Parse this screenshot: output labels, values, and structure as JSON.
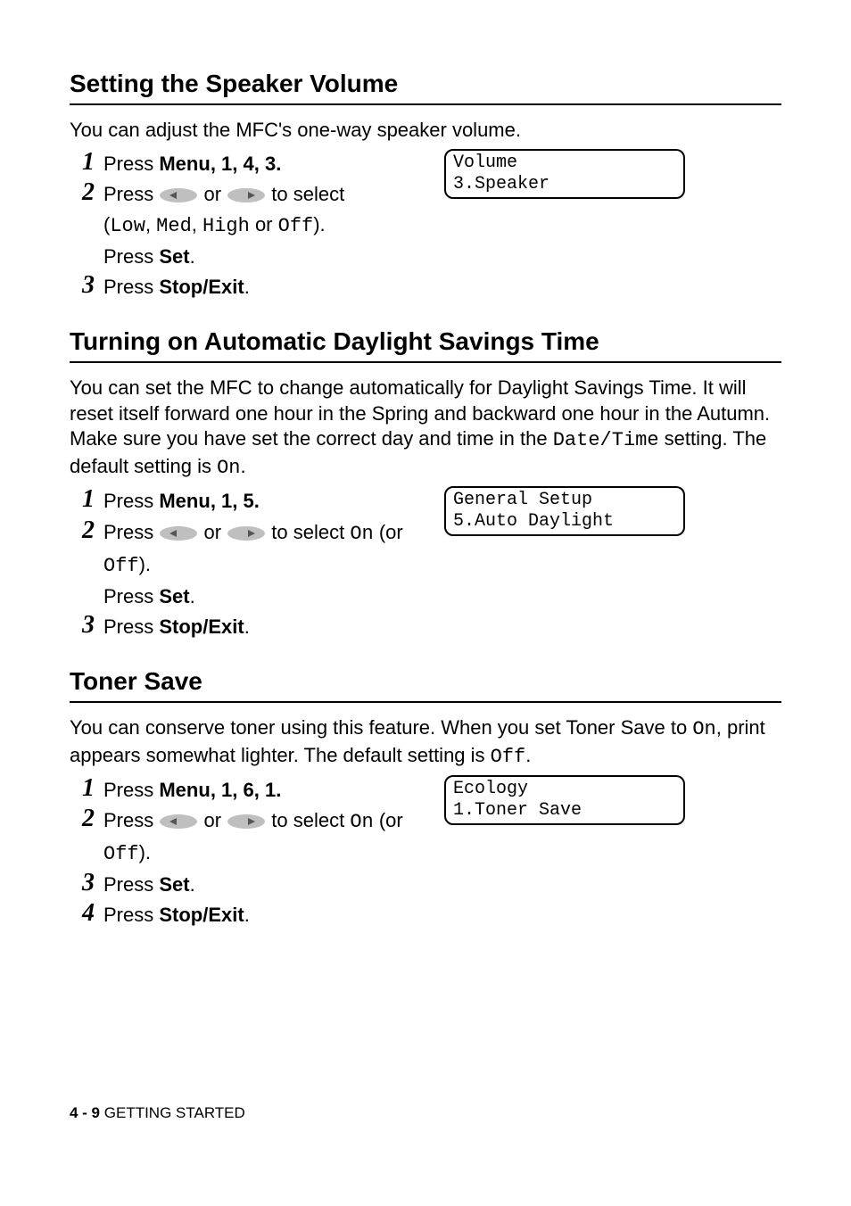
{
  "sections": [
    {
      "title": "Setting the Speaker Volume",
      "intro_plain": "You can adjust the MFC's one-way speaker volume.",
      "lcd": {
        "line1": "Volume",
        "line2": "3.Speaker"
      },
      "steps": {
        "s1": {
          "num": "1",
          "press": "Press ",
          "menu": "Menu",
          "seq": ", 1, 4, 3."
        },
        "s2": {
          "num": "2",
          "press_a": "Press ",
          "or": " or ",
          "to_select": " to select",
          "open_paren": "(",
          "low": "Low",
          "c1": ", ",
          "med": "Med",
          "c2": ", ",
          "high": "High",
          "or2": " or ",
          "off": "Off",
          "close_paren": ").",
          "press_b": "Press ",
          "set": "Set",
          "dot": "."
        },
        "s3": {
          "num": "3",
          "press": "Press ",
          "stop": "Stop/Exit",
          "dot": "."
        }
      }
    },
    {
      "title": "Turning on Automatic Daylight Savings Time",
      "intro_pre": "You can set the MFC to change automatically for Daylight Savings Time. It will reset itself forward one hour in the Spring and backward one hour in the Autumn. Make sure you have set the correct day and time in the ",
      "intro_mono": "Date/Time",
      "intro_mid": " setting. The default setting is ",
      "intro_mono2": "On",
      "intro_post": ".",
      "lcd": {
        "line1": "General Setup",
        "line2": "5.Auto Daylight"
      },
      "steps": {
        "s1": {
          "num": "1",
          "press": "Press ",
          "menu": "Menu",
          "seq": ", 1, 5."
        },
        "s2": {
          "num": "2",
          "press_a": "Press ",
          "or": " or ",
          "to_select": " to select ",
          "on": "On",
          "paren_or": " (or ",
          "off": "Off",
          "close_paren": ").",
          "press_b": "Press ",
          "set": "Set",
          "dot": "."
        },
        "s3": {
          "num": "3",
          "press": "Press ",
          "stop": "Stop/Exit",
          "dot": "."
        }
      }
    },
    {
      "title": "Toner Save",
      "intro_pre": "You can conserve toner using this feature. When you set Toner Save to ",
      "intro_mono": "On",
      "intro_mid": ", print appears somewhat lighter. The default setting is ",
      "intro_mono2": "Off",
      "intro_post": ".",
      "lcd": {
        "line1": "Ecology",
        "line2": "1.Toner Save"
      },
      "steps": {
        "s1": {
          "num": "1",
          "press": "Press ",
          "menu": "Menu",
          "seq": ", 1, 6, 1."
        },
        "s2": {
          "num": "2",
          "press_a": "Press ",
          "or": " or ",
          "to_select": " to select ",
          "on": "On",
          "paren_or": " (or ",
          "off": "Off",
          "close_paren": ")."
        },
        "s3": {
          "num": "3",
          "press": "Press ",
          "set": "Set",
          "dot": "."
        },
        "s4": {
          "num": "4",
          "press": "Press ",
          "stop": "Stop/Exit",
          "dot": "."
        }
      }
    }
  ],
  "footer": {
    "page": "4 - 9",
    "chapter": "   GETTING STARTED"
  }
}
